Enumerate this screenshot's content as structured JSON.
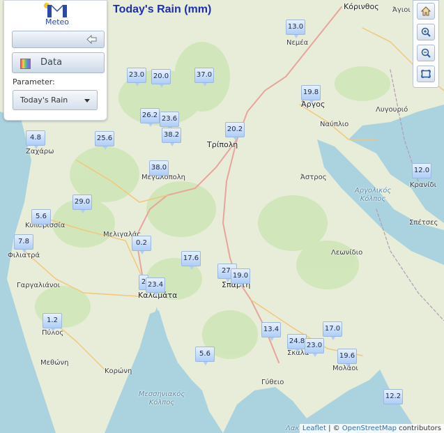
{
  "app": {
    "logo_text": "Meteo",
    "title": "Today's Rain (mm)"
  },
  "panel": {
    "data_button": "Data",
    "parameter_label": "Parameter:",
    "parameter_value": "Today's Rain"
  },
  "attribution": {
    "leaflet": "Leaflet",
    "sep": " | © ",
    "osm": "OpenStreetMap",
    "tail": " contributors"
  },
  "stations": [
    {
      "v": "13.0"
    },
    {
      "v": "19.8"
    },
    {
      "v": "23.0"
    },
    {
      "v": "20.0"
    },
    {
      "v": "37.0"
    },
    {
      "v": "26.2"
    },
    {
      "v": "23.6"
    },
    {
      "v": "38.2"
    },
    {
      "v": "20.2"
    },
    {
      "v": "4.8"
    },
    {
      "v": "25.6"
    },
    {
      "v": "38.0"
    },
    {
      "v": "12.0"
    },
    {
      "v": "29.0"
    },
    {
      "v": "5.6"
    },
    {
      "v": "7.8"
    },
    {
      "v": "0.2"
    },
    {
      "v": "17.6"
    },
    {
      "v": "27."
    },
    {
      "v": "19.0"
    },
    {
      "v": "2"
    },
    {
      "v": "23.4"
    },
    {
      "v": "1.2"
    },
    {
      "v": "13.4"
    },
    {
      "v": "17.0"
    },
    {
      "v": "24.8"
    },
    {
      "v": "23.0"
    },
    {
      "v": "19.6"
    },
    {
      "v": "5.6"
    },
    {
      "v": "12.2"
    }
  ],
  "places": {
    "korinthos": "Κόρινθος",
    "agioi": "Άγιοι",
    "nemea": "Νεμέα",
    "argos": "Άργος",
    "lygourio": "Λυγουριό",
    "nafplio": "Ναύπλιο",
    "tripoli": "Τρίπολη",
    "zacharo": "Ζαχάρω",
    "megalopoli": "Μεγαλόπολη",
    "astros": "Άστρος",
    "argolikos": "Αργολικός Κόλπος",
    "kranidi": "Κρανίδι",
    "spetses": "Σπέτσες",
    "kyparissia": "Κυπαρισσία",
    "meligalas": "Μελιγαλάς",
    "filiatra": "Φιλιατρά",
    "leonidio": "Λεωνίδιο",
    "gargaliani": "Γαργαλιάνοι",
    "sparti": "Σπάρτη",
    "kalamata": "Καλαμάτα",
    "pylos": "Πύλος",
    "methoni": "Μεθώνη",
    "koroni": "Κορώνη",
    "skala": "Σκάλα",
    "molaoi": "Μολάοι",
    "gytheio": "Γύθειο",
    "messiniakos": "Μεσσηνιακός Κόλπος",
    "lakon": "Λακω"
  }
}
